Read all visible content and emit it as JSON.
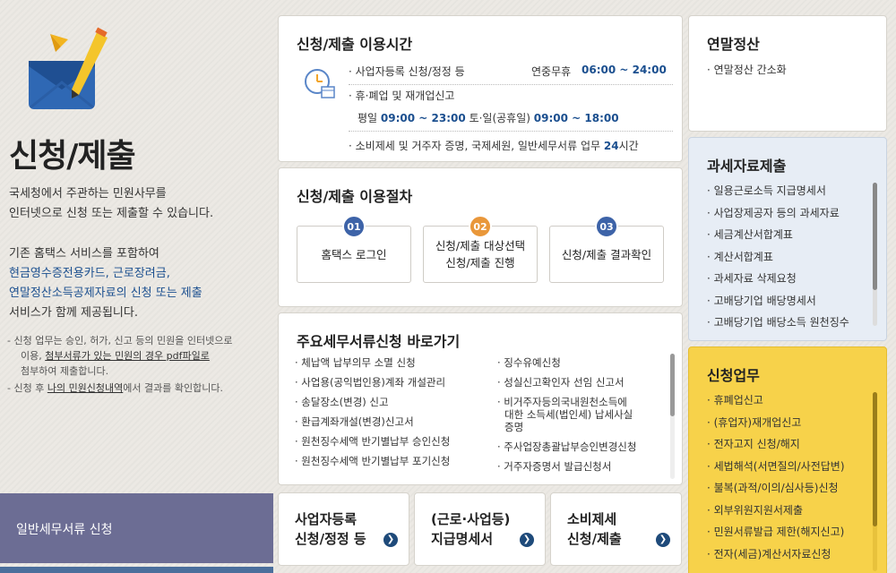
{
  "left": {
    "title": "신청/제출",
    "intro_line1": "국세청에서 주관하는 민원사무를",
    "intro_line2": "인터넷으로 신청 또는 제출할 수 있습니다.",
    "intro2_line1": "기존 홈택스 서비스를 포함하여",
    "intro2_line2": "현금영수증전용카드, 근로장려금,",
    "intro2_line3": "연말정산소득공제자료의 신청 또는 제출",
    "intro2_line4": "서비스가 함께 제공됩니다.",
    "note1_a": "- 신청 업무는 승인, 허가, 신고 등의 민원을 인터넷으로",
    "note1_b": "이용, ",
    "note1_u": "첨부서류가 있는 민원의 경우 pdf파일로",
    "note1_c": "첨부하여 제출합니다.",
    "note2_a": "- 신청 후 ",
    "note2_u": "나의 민원신청내역",
    "note2_b": "에서 결과를 확인합니다.",
    "tab_label": "일반세무서류 신청"
  },
  "hours": {
    "title": "신청/제출 이용시간",
    "row1_label": "· 사업자등록 신청/정정 등",
    "row1_mid": "연중무휴",
    "row1_time": "06:00 ~ 24:00",
    "row2_label": "· 휴·폐업 및 재개업신고",
    "row3_a": "평일",
    "row3_t1": "09:00 ~ 23:00",
    "row3_b": "토·일(공휴일)",
    "row3_t2": "09:00 ~ 18:00",
    "row4_label": "· 소비제세 및 거주자 증명, 국제세원, 일반세무서류 업무",
    "row4_time": "24",
    "row4_unit": "시간"
  },
  "steps": {
    "title": "신청/제출 이용절차",
    "items": [
      {
        "num": "01",
        "line1": "홈택스 로그인",
        "line2": ""
      },
      {
        "num": "02",
        "line1": "신청/제출 대상선택",
        "line2": "신청/제출 진행"
      },
      {
        "num": "03",
        "line1": "신청/제출 결과확인",
        "line2": ""
      }
    ]
  },
  "forms": {
    "title": "주요세무서류신청 바로가기",
    "left": [
      "· 체납액 납부의무 소멸 신청",
      "· 사업용(공익법인용)계좌 개설관리",
      "· 송달장소(변경) 신고",
      "· 환급계좌개설(변경)신고서",
      "· 원천징수세액 반기별납부 승인신청",
      "· 원천징수세액 반기별납부 포기신청"
    ],
    "right": [
      "· 징수유예신청",
      "· 성실신고확인자 선임 신고서",
      "· 비거주자등의국내원천소득에",
      "대한 소득세(법인세) 납세사실",
      "증명",
      "· 주사업장총괄납부승인변경신청",
      "· 거주자증명서 발급신청서"
    ]
  },
  "buttons": [
    {
      "line1": "사업자등록",
      "line2": "신청/정정 등"
    },
    {
      "line1": "(근로·사업등)",
      "line2": "지급명세서"
    },
    {
      "line1": "소비제세",
      "line2": "신청/제출"
    }
  ],
  "year_end": {
    "title": "연말정산",
    "items": [
      "· 연말정산 간소화"
    ]
  },
  "tax_data": {
    "title": "과세자료제출",
    "items": [
      "· 일용근로소득 지급명세서",
      "· 사업장제공자 등의 과세자료",
      "· 세금계산서합계표",
      "· 계산서합계표",
      "· 과세자료 삭제요청",
      "· 고배당기업 배당명세서",
      "· 고배당기업 배당소득 원천징수"
    ]
  },
  "apply": {
    "title": "신청업무",
    "items": [
      "· 휴폐업신고",
      "· (휴업자)재개업신고",
      "· 전자고지 신청/해지",
      "· 세법해석(서면질의/사전답변)",
      "· 불복(과적/이의/심사등)신청",
      "· 외부위원지원서제출",
      "· 민원서류발급 제한(해지신고)",
      "· 전자(세금)계산서자료신청"
    ]
  },
  "colors": {
    "step1": "#3d63a8",
    "step2": "#e9973a",
    "step3": "#3d63a8",
    "left_tab": "#6c6d94",
    "apply_bg": "#f7d24a"
  }
}
